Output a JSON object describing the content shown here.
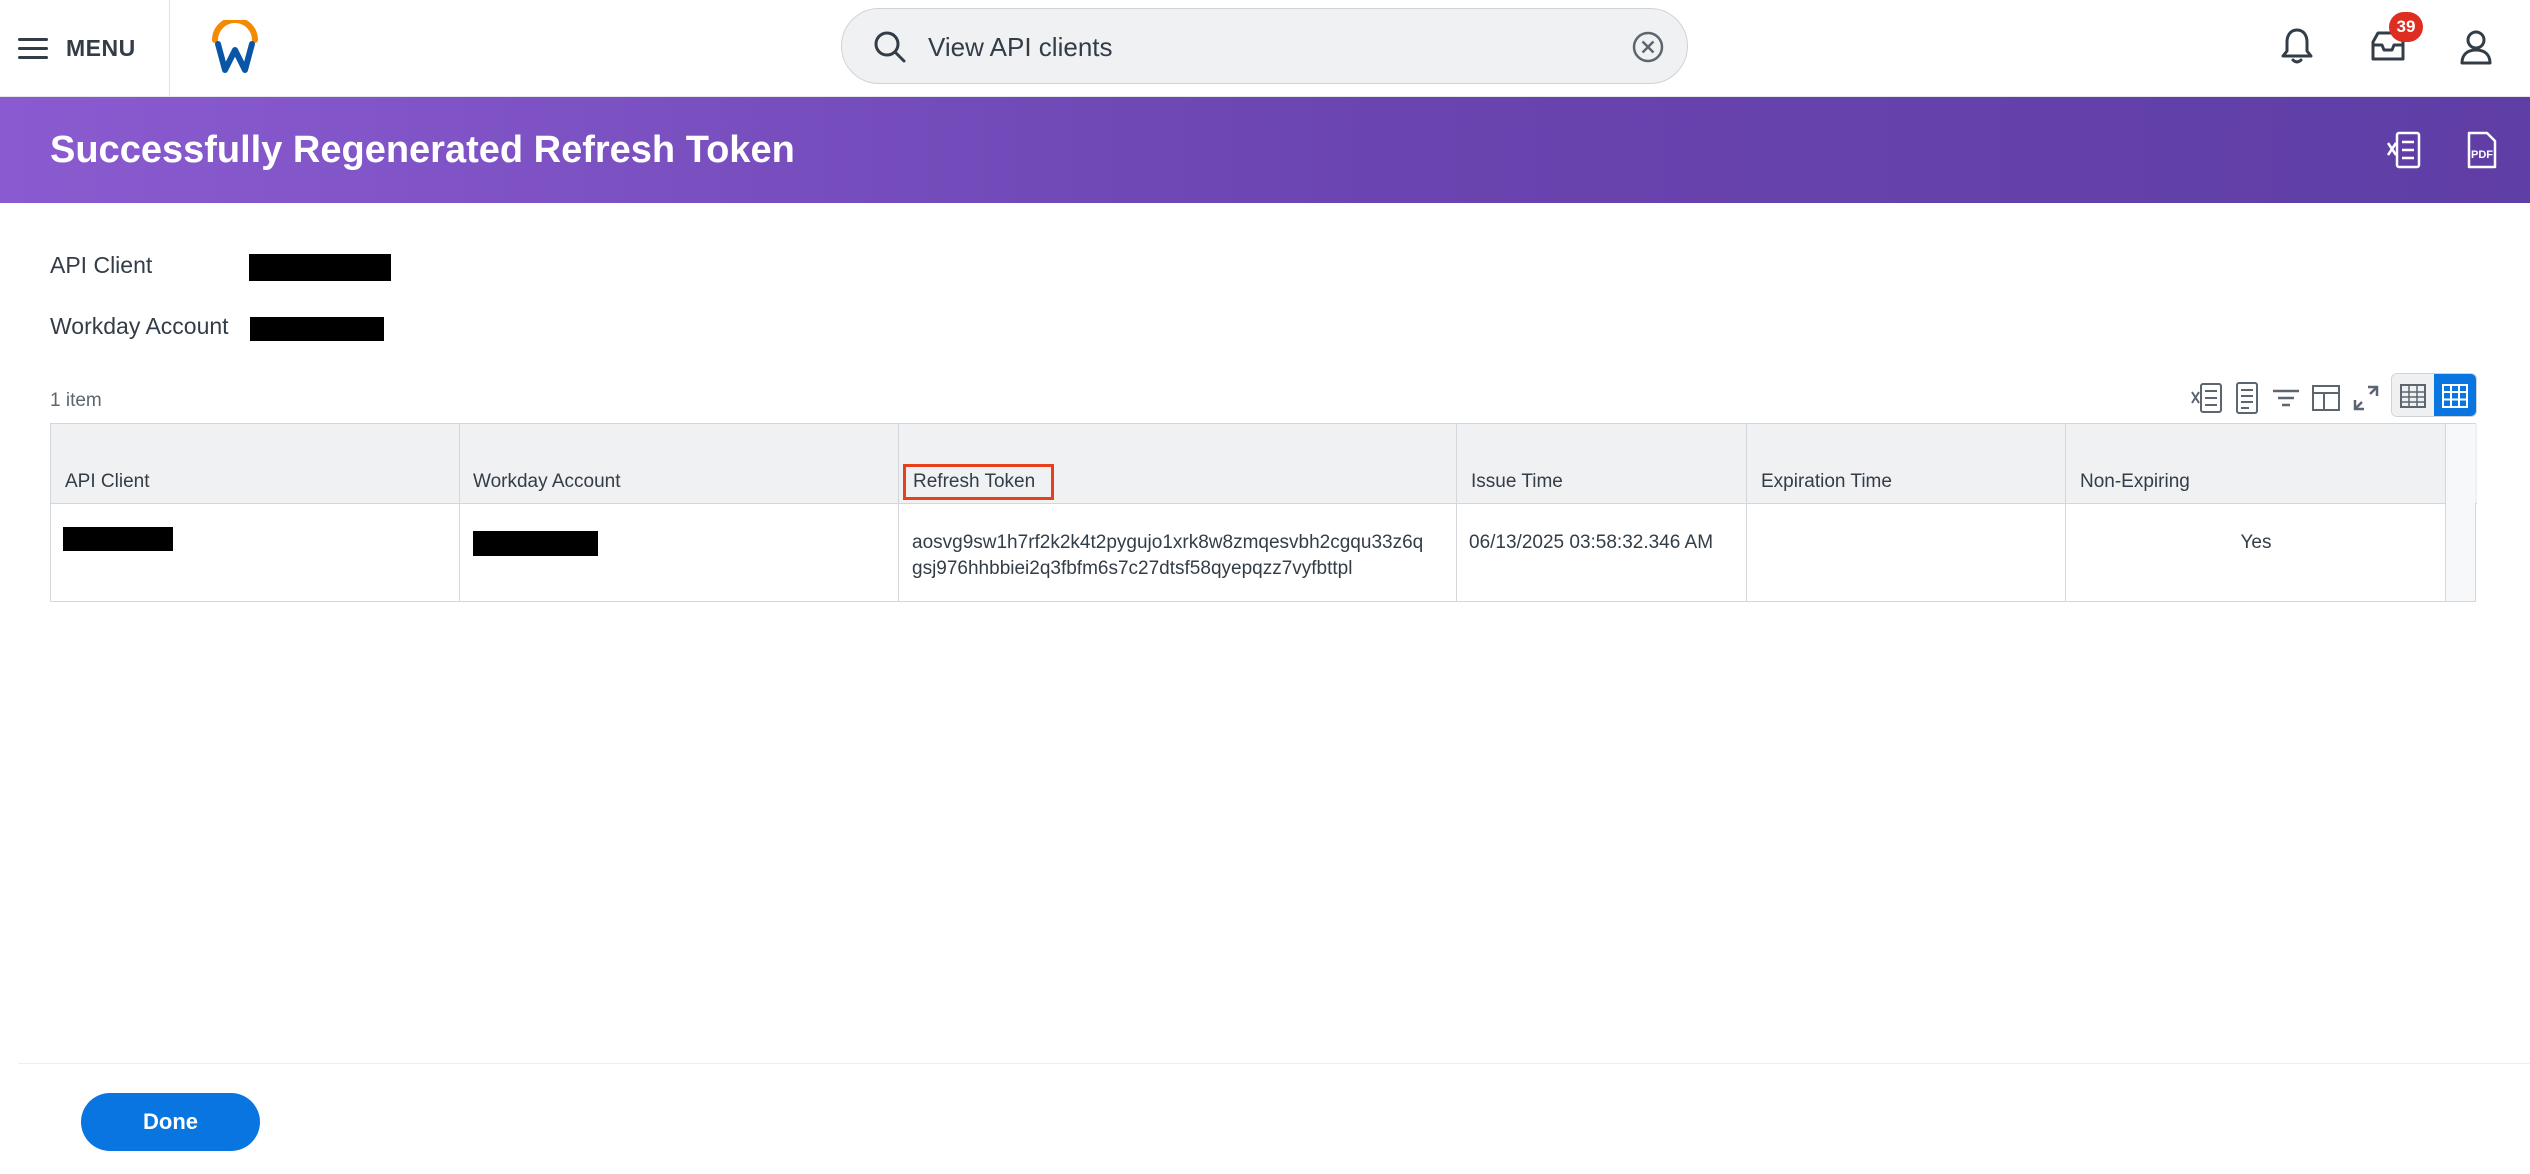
{
  "topbar": {
    "menu_label": "MENU",
    "search_text": "View API clients",
    "notifications_badge": "39",
    "icons": [
      "hamburger-icon",
      "workday-logo",
      "search-icon",
      "clear-icon",
      "bell-icon",
      "inbox-icon",
      "user-icon"
    ]
  },
  "header": {
    "title": "Successfully Regenerated Refresh Token",
    "icons": [
      "export-excel-icon",
      "export-pdf-icon"
    ],
    "gradient_start": "#8a5bd0",
    "gradient_end": "#5f3ea6"
  },
  "fields": {
    "api_client_label": "API Client",
    "workday_account_label": "Workday Account",
    "api_client_value": "[redacted]",
    "workday_account_value": "[redacted]"
  },
  "table": {
    "item_count": "1 item",
    "columns": [
      "API Client",
      "Workday Account",
      "Refresh Token",
      "Issue Time",
      "Expiration Time",
      "Non-Expiring"
    ],
    "rows": [
      {
        "api_client": "[redacted]",
        "workday_account": "[redacted]",
        "refresh_token_line1": "aosvg9sw1h7rf2k2k4t2pygujo1xrk8w8zmqesvbh2cgqu33z6q",
        "refresh_token_line2": "gsj976hhbbiei2q3fbfm6s7c27dtsf58qyepqzz7vyfbttpl",
        "issue_time": "06/13/2025 03:58:32.346 AM",
        "expiration_time": "",
        "non_expiring": "Yes"
      }
    ],
    "highlighted_column": "Refresh Token",
    "highlight_color": "#e8401c"
  },
  "footer": {
    "done_label": "Done"
  },
  "colors": {
    "accent": "#0875e1",
    "badge": "#de2e21"
  }
}
